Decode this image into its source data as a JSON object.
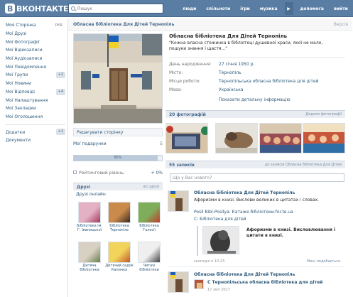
{
  "header": {
    "logo_text": "ВКОНТАКТЕ",
    "logo_icon": "vk-logo",
    "search_placeholder": "Пошук",
    "nav": [
      "люди",
      "спільноти",
      "ігри",
      "музика",
      "допомога",
      "вийти"
    ],
    "player_icon": "play-icon"
  },
  "sidebar": {
    "items": [
      {
        "label": "Моя Сторінка",
        "badge": "ред."
      },
      {
        "label": "Мої Друзі",
        "badge": ""
      },
      {
        "label": "Мої Фотографії",
        "badge": ""
      },
      {
        "label": "Мої Відеозаписи",
        "badge": ""
      },
      {
        "label": "Мої Аудіозаписи",
        "badge": ""
      },
      {
        "label": "Мої Повідомлення",
        "badge": ""
      },
      {
        "label": "Мої Групи",
        "badge": "+2"
      },
      {
        "label": "Мої Новини",
        "badge": ""
      },
      {
        "label": "Мої Відповіді",
        "badge": "+4"
      },
      {
        "label": "Мої Налаштування",
        "badge": ""
      },
      {
        "label": "Мої Закладки",
        "badge": ""
      },
      {
        "label": "Мої Оголошення",
        "badge": ""
      }
    ],
    "extra": [
      {
        "label": "Додатки",
        "badge": "+1"
      },
      {
        "label": "Документи",
        "badge": ""
      }
    ]
  },
  "breadcrumb": {
    "title": "Обласна бібліотека Для Дітей Тернопіль",
    "help": "Версія"
  },
  "profile": {
    "name": "Обласна бібліотека Для Дітей Тернопіль",
    "status": "\"Кожна власна стежинка в бібліотеці душевної краси, якої не мало, пошуки знання і щастя...\"",
    "info": [
      {
        "key": "День народження:",
        "value": "27 січня 1950 р."
      },
      {
        "key": "Місто:",
        "value": "Тернопіль"
      },
      {
        "key": "Місце роботи:",
        "value": "Тернопільська обласна бібліотека для дітей"
      },
      {
        "key": "Мова:",
        "value": "Українська"
      }
    ],
    "details_link": "Показати детальну інформацію"
  },
  "left_column": {
    "edit_page": "Редагувати сторінку",
    "my_gifts": "Мої подарунки",
    "my_gifts_count": "5",
    "progress_text": "95%",
    "progress_fraction": 0.95,
    "rating_label": "Рейтинговий рівень:",
    "rating_value": "+ 0%",
    "friends_title": "Друзі",
    "friends_all": "всі друзі",
    "friends_online": "Друзі онлайн",
    "friends": [
      {
        "name": "Бібліотека ім. Г. Іваницької"
      },
      {
        "name": "Бібліотека Тернопіль"
      },
      {
        "name": "Бібліотека Голосії"
      },
      {
        "name": "Дитяча бібліотека"
      },
      {
        "name": "Дитячий садок Калинка"
      },
      {
        "name": "Читачі бібліотеки"
      }
    ]
  },
  "photos": {
    "title": "20 фотографій",
    "add": "Додати фотографії",
    "count": 4
  },
  "wall": {
    "title": "55 записів",
    "subtitle": "до записів Обласна бібліотека Для Дітей",
    "input_placeholder": "Що у Вас нового?",
    "posts": [
      {
        "author": "Обласна бібліотека Для Дітей Тернопіль",
        "text": "Афоризми в книзі. Вислови великих в цитатах і словах.",
        "link": "Posil Bibl-Posilya: Катаже бібліотеки-for.te.ua",
        "link2": "С: Бібліотека для дітей",
        "attach_title": "Афоризми в книзі. Висловлювання і цитати в книзі.",
        "time": "сьогодні о 10:23",
        "like": "Мені подобається"
      },
      {
        "author": "Обласна бібліотека Для Дітей Тернопіль",
        "text": "С Тернопільська обласна бібліотека для дітей",
        "time": "17 лип 2017"
      }
    ]
  },
  "colors": {
    "header_bg": "#597da3",
    "link": "#2b587a",
    "block_head": "#e9edf1"
  }
}
